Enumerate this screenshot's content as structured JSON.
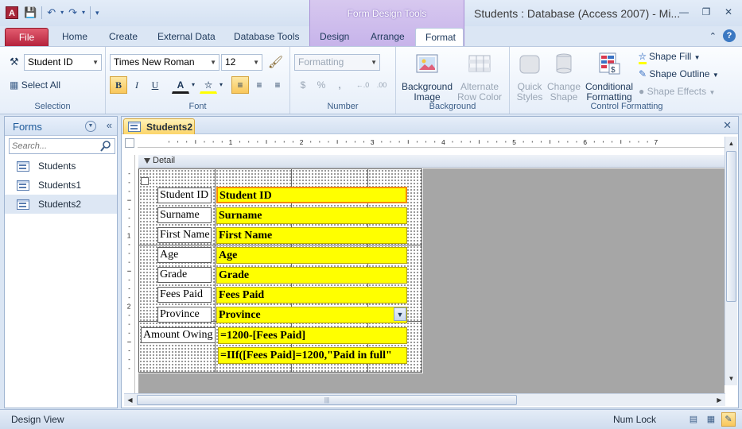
{
  "titlebar": {
    "app_icon_letter": "A",
    "contextual_title": "Form Design Tools",
    "window_title": "Students : Database (Access 2007) - Mi..."
  },
  "tabs": {
    "file": "File",
    "home": "Home",
    "create": "Create",
    "external_data": "External Data",
    "database_tools": "Database Tools",
    "design": "Design",
    "arrange": "Arrange",
    "format": "Format"
  },
  "ribbon": {
    "selection": {
      "object_combo": "Student ID",
      "select_all": "Select All",
      "label": "Selection"
    },
    "font": {
      "font_name": "Times New Roman",
      "font_size": "12",
      "bold": "B",
      "italic": "I",
      "underline": "U",
      "label": "Font"
    },
    "number": {
      "format_combo": "Formatting",
      "currency": "$",
      "percent": "%",
      "comma": ",",
      "inc_decimals": "←.0",
      "dec_decimals": ".00",
      "label": "Number"
    },
    "background": {
      "background_image": "Background Image",
      "alternate_row_color": "Alternate Row Color",
      "label": "Background"
    },
    "control_formatting": {
      "quick_styles": "Quick Styles",
      "change_shape": "Change Shape",
      "conditional_formatting": "Conditional Formatting",
      "shape_fill": "Shape Fill",
      "shape_outline": "Shape Outline",
      "shape_effects": "Shape Effects",
      "label": "Control Formatting"
    }
  },
  "nav": {
    "title": "Forms",
    "search_placeholder": "Search...",
    "items": [
      {
        "label": "Students"
      },
      {
        "label": "Students1"
      },
      {
        "label": "Students2"
      }
    ]
  },
  "document": {
    "tab_label": "Students2",
    "section_label": "Detail",
    "ruler_numbers": [
      "1",
      "2",
      "3",
      "4",
      "5",
      "6",
      "7"
    ],
    "left_ruler_numbers": [
      "1",
      "2"
    ],
    "controls": [
      {
        "label": "Student ID",
        "value": "Student ID"
      },
      {
        "label": "Surname",
        "value": "Surname"
      },
      {
        "label": "First Name",
        "value": "First Name"
      },
      {
        "label": "Age",
        "value": "Age"
      },
      {
        "label": "Grade",
        "value": "Grade"
      },
      {
        "label": "Fees Paid",
        "value": "Fees Paid"
      },
      {
        "label": "Province",
        "value": "Province"
      },
      {
        "label": "Amount Owing",
        "value": "=1200-[Fees Paid]"
      },
      {
        "label": "",
        "value": "=IIf([Fees Paid]=1200,\"Paid in full\""
      }
    ]
  },
  "statusbar": {
    "view": "Design View",
    "num_lock": "Num Lock"
  },
  "colors": {
    "textbox_fill": "#ffff00",
    "file_tab": "#b3203a",
    "contextual_tab": "#c6b3ea",
    "active_highlight": "#f9c75b"
  }
}
